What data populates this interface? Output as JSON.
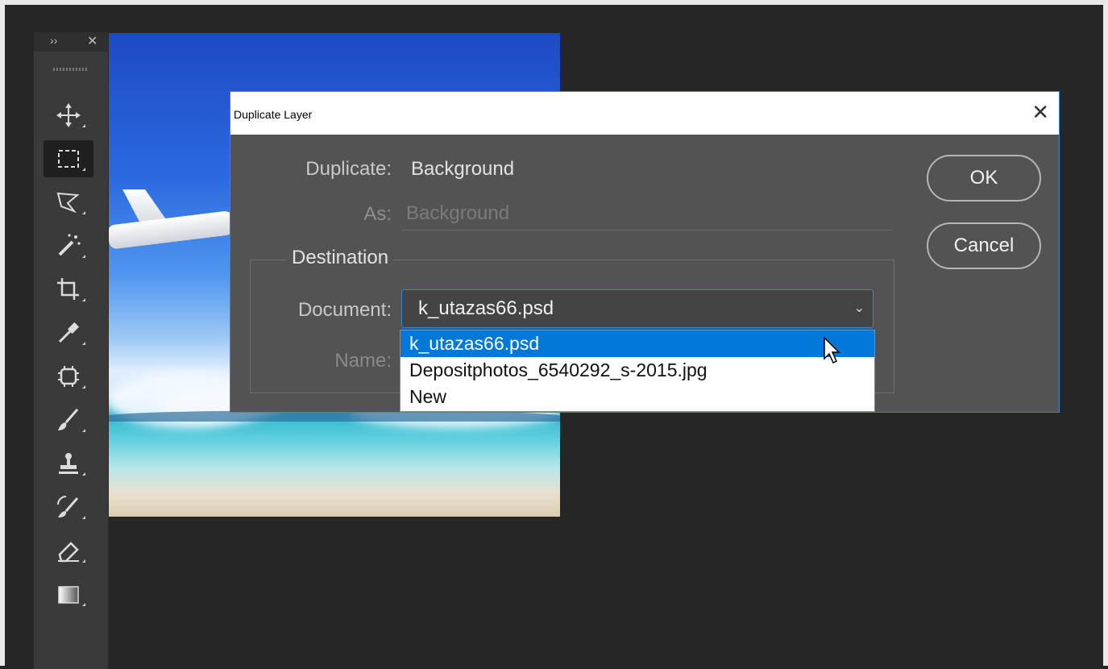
{
  "toolbar": {
    "collapse_icon": "››",
    "close_icon": "✕",
    "tools": [
      "move-tool",
      "marquee-tool",
      "lasso-tool",
      "magic-wand-tool",
      "crop-tool",
      "eyedropper-tool",
      "spot-healing-tool",
      "brush-tool",
      "clone-stamp-tool",
      "history-brush-tool",
      "eraser-tool",
      "gradient-tool"
    ],
    "active_tool": "marquee-tool"
  },
  "dialog": {
    "title": "Duplicate Layer",
    "close_symbol": "✕",
    "duplicate_label": "Duplicate:",
    "duplicate_value": "Background",
    "as_label": "As:",
    "as_value": "Background",
    "destination_title": "Destination",
    "document_label": "Document:",
    "document_value": "k_utazas66.psd",
    "chevron": "⌄",
    "name_label": "Name:",
    "ok_label": "OK",
    "cancel_label": "Cancel",
    "dropdown_options": [
      "k_utazas66.psd",
      "Depositphotos_6540292_s-2015.jpg",
      "New"
    ],
    "selected_index": 0
  },
  "colors": {
    "accent": "#0078d7",
    "dialog_bg": "#535353",
    "app_bg": "#262626"
  }
}
